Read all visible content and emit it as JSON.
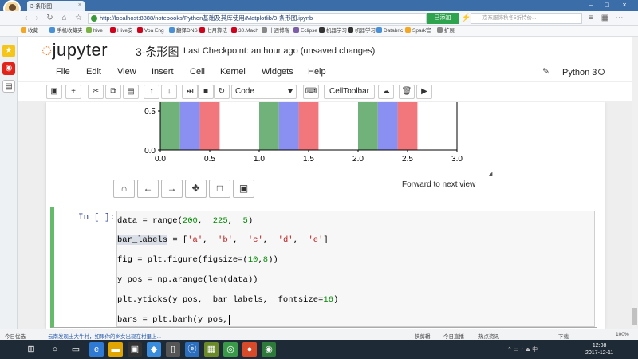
{
  "browser": {
    "tab_title": "3-条形图",
    "url": "http://localhost:8888/notebooks/Python基础及其库使用/Matplotlib/3-条形图.ipynb",
    "green_button": "已添加",
    "search_placeholder": "京东服饰秋冬5折特价...",
    "bookmarks": [
      {
        "label": "收藏",
        "color": "#f5a623"
      },
      {
        "label": "手机收藏夹",
        "color": "#4a90d9"
      },
      {
        "label": "hive",
        "color": "#7bb342"
      },
      {
        "label": "Hive安",
        "color": "#d0021b"
      },
      {
        "label": "Voa Eng",
        "color": "#d0021b"
      },
      {
        "label": "翻译DNS",
        "color": "#4a90d9"
      },
      {
        "label": "七月算法",
        "color": "#d0021b"
      },
      {
        "label": "30.Mach",
        "color": "#d0021b"
      },
      {
        "label": "十週博客",
        "color": "#888888"
      },
      {
        "label": "Eclipse",
        "color": "#7b5ea7"
      },
      {
        "label": "机器学习",
        "color": "#333333"
      },
      {
        "label": "机器学习",
        "color": "#333333"
      },
      {
        "label": "Databric",
        "color": "#4a90d9"
      },
      {
        "label": "Spark官",
        "color": "#f5a623"
      },
      {
        "label": "扩展",
        "color": "#888888"
      }
    ]
  },
  "jupyter": {
    "logo_text": "jupyter",
    "notebook_name": "3-条形图",
    "checkpoint": "Last Checkpoint: an hour ago (unsaved changes)",
    "menu": [
      "File",
      "Edit",
      "View",
      "Insert",
      "Cell",
      "Kernel",
      "Widgets",
      "Help"
    ],
    "kernel_name": "Python 3",
    "cell_type": "Code",
    "celltoolbar_label": "CellToolbar",
    "toolbar_icons": [
      "save-icon",
      "plus-icon",
      "cut-icon",
      "copy-icon",
      "paste-icon",
      "arrow-up-icon",
      "arrow-down-icon",
      "step-forward-icon",
      "stop-icon",
      "refresh-icon",
      "keyboard-icon",
      "upload-icon",
      "trash-icon",
      "video-icon"
    ]
  },
  "figure": {
    "forward_text": "Forward to next view",
    "tools": [
      "home-icon",
      "arrow-left-icon",
      "arrow-right-icon",
      "move-icon",
      "zoom-rect-icon",
      "save-figure-icon"
    ]
  },
  "chart_data": {
    "type": "bar",
    "xlim": [
      0.0,
      3.0
    ],
    "ylim_visible": [
      0.0,
      0.5
    ],
    "xticks": [
      "0.0",
      "0.5",
      "1.0",
      "1.5",
      "2.0",
      "2.5",
      "3.0"
    ],
    "yticks": [
      "0.0",
      "0.5"
    ],
    "series": [
      {
        "color": "#71b27a",
        "x": [
          0.0,
          1.0,
          2.0
        ],
        "width": 0.2
      },
      {
        "color": "#8a8ff2",
        "x": [
          0.2,
          1.2,
          2.2
        ],
        "width": 0.2
      },
      {
        "color": "#f2777c",
        "x": [
          0.4,
          1.4,
          2.4
        ],
        "width": 0.2
      }
    ]
  },
  "cell": {
    "prompt": "In [ ]:",
    "lines": [
      [
        "data = range(",
        "200",
        ",  ",
        "225",
        ",  ",
        "5",
        ")"
      ],
      [
        "bar_labels",
        " = [",
        "'a'",
        ",  ",
        "'b'",
        ",  ",
        "'c'",
        ",  ",
        "'d'",
        ",  ",
        "'e'",
        "]"
      ],
      [
        "fig = plt.figure(figsize=(",
        "10",
        ",",
        "8",
        "))"
      ],
      [
        "y_pos = np.arange(len(data))"
      ],
      [
        "plt.yticks(y_pos,  bar_labels,  fontsize=",
        "16",
        ")"
      ],
      [
        "bars = plt.barh(y_pos,"
      ]
    ]
  },
  "statusbar": {
    "left": "今日优选",
    "news": "云南发现土大牛村，如果你的乡女出现在村里上...",
    "items": [
      "快剪辑",
      "今日直播",
      "热点资讯",
      "下载",
      "100%"
    ]
  },
  "taskbar": {
    "time": "12:08",
    "date": "2017-12-11"
  }
}
